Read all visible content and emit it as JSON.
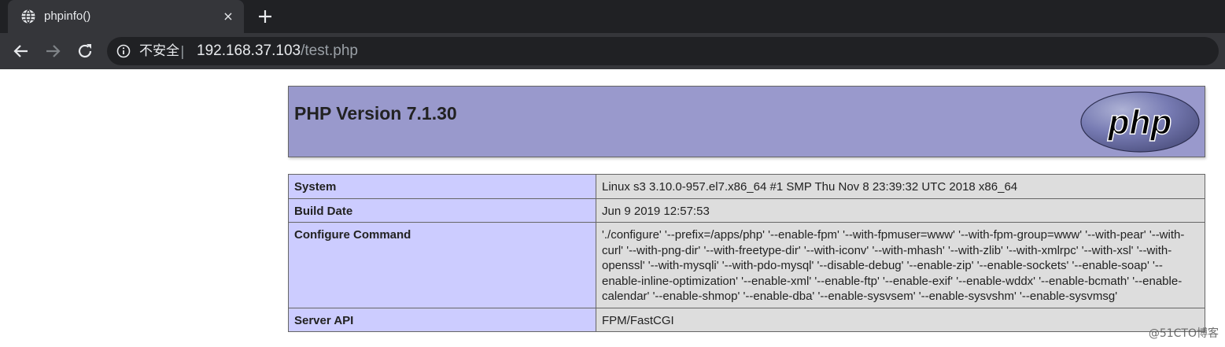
{
  "browser": {
    "tab_title": "phpinfo()",
    "close_symbol": "×",
    "security_label": "不安全",
    "separator": "|",
    "url_host": "192.168.37.103",
    "url_path": "/test.php",
    "icons": [
      "globe-icon",
      "close-icon",
      "plus-icon",
      "back-icon",
      "forward-icon",
      "reload-icon",
      "info-icon"
    ]
  },
  "page": {
    "title": "PHP Version 7.1.30",
    "logo_text": "php",
    "rows": [
      {
        "key": "System",
        "value": "Linux s3 3.10.0-957.el7.x86_64 #1 SMP Thu Nov 8 23:39:32 UTC 2018 x86_64"
      },
      {
        "key": "Build Date",
        "value": "Jun 9 2019 12:57:53"
      },
      {
        "key": "Configure Command",
        "value": "'./configure' '--prefix=/apps/php' '--enable-fpm' '--with-fpmuser=www' '--with-fpm-group=www' '--with-pear' '--with-curl' '--with-png-dir' '--with-freetype-dir' '--with-iconv' '--with-mhash' '--with-zlib' '--with-xmlrpc' '--with-xsl' '--with-openssl' '--with-mysqli' '--with-pdo-mysql' '--disable-debug' '--enable-zip' '--enable-sockets' '--enable-soap' '--enable-inline-optimization' '--enable-xml' '--enable-ftp' '--enable-exif' '--enable-wddx' '--enable-bcmath' '--enable-calendar' '--enable-shmop' '--enable-dba' '--enable-sysvsem' '--enable-sysvshm' '--enable-sysvmsg'"
      },
      {
        "key": "Server API",
        "value": "FPM/FastCGI"
      }
    ],
    "watermark": "@51CTO博客"
  },
  "colors": {
    "header_bg": "#9999cc",
    "key_bg": "#ccccff",
    "value_bg": "#dddddd",
    "chrome_dark": "#202124",
    "chrome_toolbar": "#35363a"
  }
}
